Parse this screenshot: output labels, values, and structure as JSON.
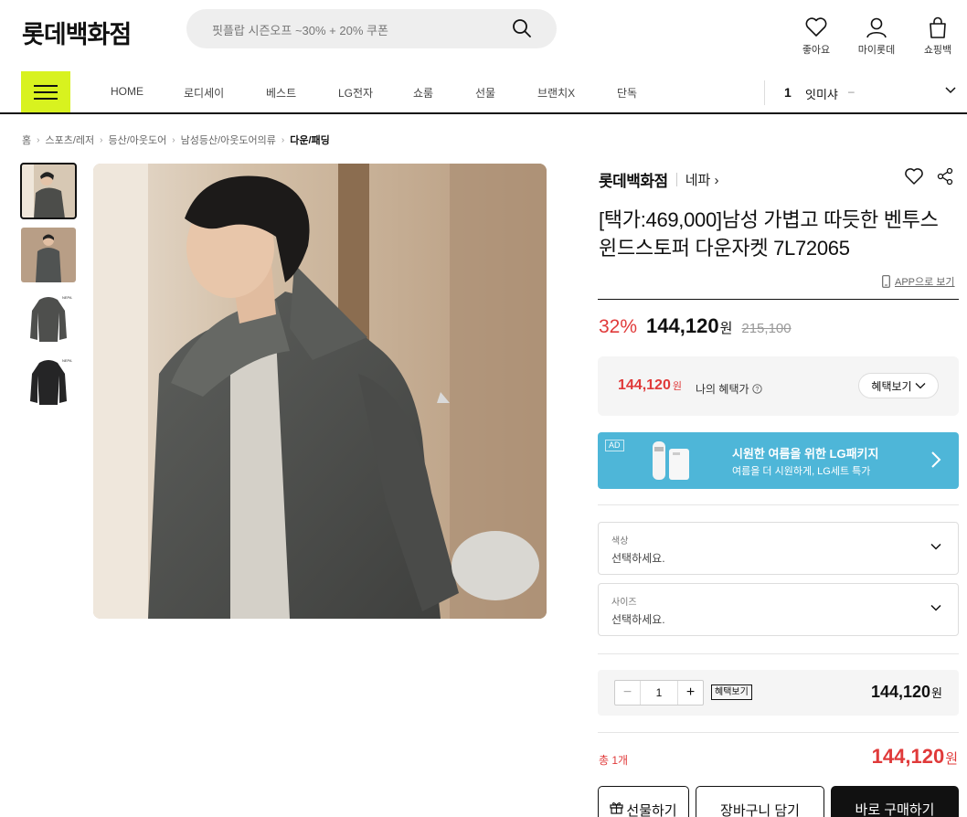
{
  "header": {
    "logo": "롯데백화점",
    "search_placeholder": "핏플랍 시즌오프 ~30% + 20% 쿠폰",
    "utils": [
      {
        "label": "좋아요",
        "icon": "heart-icon"
      },
      {
        "label": "마이롯데",
        "icon": "person-icon"
      },
      {
        "label": "쇼핑백",
        "icon": "shopping-bag-icon"
      }
    ]
  },
  "nav": {
    "items": [
      "HOME",
      "로디세이",
      "베스트",
      "LG전자",
      "쇼룸",
      "선물",
      "브랜치X",
      "단독"
    ],
    "ranking": {
      "rank": "1",
      "keyword": "잇미샤",
      "change": "–"
    }
  },
  "breadcrumb": [
    "홈",
    "스포츠/레저",
    "등산/아웃도어",
    "남성등산/아웃도어의류",
    "다운/패딩"
  ],
  "product": {
    "brand": "롯데백화점",
    "sub_brand": "네파 ›",
    "title": "[택가:469,000]남성 가볍고 따듯한 벤투스 윈드스토퍼 다운자켓 7L72065",
    "app_view": "APP으로 보기",
    "discount": "32%",
    "price": "144,120",
    "won": "원",
    "original_price": "215,100",
    "benefit_price": "144,120",
    "benefit_won": "원",
    "benefit_label": "나의 혜택가",
    "benefit_button": "혜택보기"
  },
  "ad": {
    "tag": "AD",
    "title": "시원한 여름을 위한 LG패키지",
    "subtitle": "여름을 더 시원하게, LG세트 특가"
  },
  "options": [
    {
      "label": "색상",
      "value": "선택하세요."
    },
    {
      "label": "사이즈",
      "value": "선택하세요."
    }
  ],
  "quantity": {
    "minus": "−",
    "value": "1",
    "plus": "+",
    "benefit_tag": "혜택보기",
    "price": "144,120",
    "won": "원"
  },
  "total": {
    "label": "총 1개",
    "price": "144,120",
    "won": "원"
  },
  "buttons": {
    "gift": "선물하기",
    "cart": "장바구니 담기",
    "buy": "바로 구매하기"
  },
  "colors": {
    "accent_lime": "#d8f21f",
    "sale_red": "#e03a3a",
    "ad_blue": "#4eb6d8"
  }
}
